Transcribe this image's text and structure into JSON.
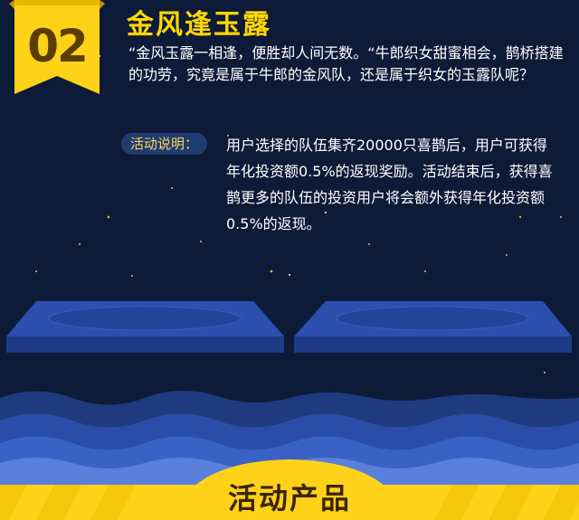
{
  "section": {
    "number": "02",
    "title": "金风逢玉露",
    "intro": "“金风玉露一相逢，便胜却人间无数。“牛郎织女甜蜜相会，鹊桥搭建的功劳，究竟是属于牛郎的金风队，还是属于织女的玉露队呢？"
  },
  "description": {
    "label": "活动说明：",
    "text": "用户选择的队伍集齐20000只喜鹊后，用户可获得年化投资额0.5%的返现奖励。活动结束后，获得喜鹊更多的队伍的投资用户将会额外获得年化投资额0.5%的返现。"
  },
  "footer": {
    "title": "活动产品"
  },
  "colors": {
    "background": "#0d1b38",
    "accent": "#ffd700",
    "platform": "#2d4fae",
    "wave_light": "#3b5cc4",
    "banner": "#ffd21a"
  }
}
